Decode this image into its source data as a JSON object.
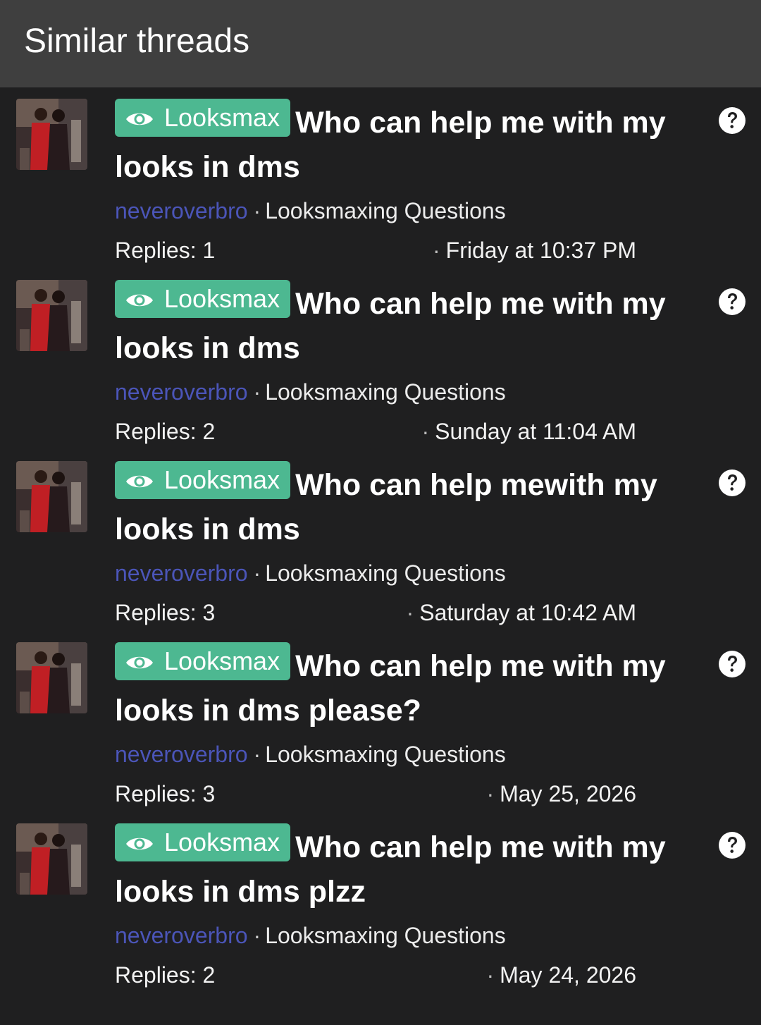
{
  "header": {
    "title": "Similar threads"
  },
  "colors": {
    "prefix_bg": "#4db891",
    "author": "#4b55b8",
    "background": "#1f1f20",
    "header_bg": "#3f3f3f"
  },
  "threads": [
    {
      "prefix": "Looksmax",
      "title": "Who can help me with my looks in dms",
      "author": "neveroverbro",
      "separator": "·",
      "forum": "Looksmaxing Questions",
      "replies": "Replies: 1",
      "date_dot": "·",
      "date": "Friday at 10:37 PM",
      "icon": "question-circle-icon"
    },
    {
      "prefix": "Looksmax",
      "title": "Who can help me with my looks in dms",
      "author": "neveroverbro",
      "separator": "·",
      "forum": "Looksmaxing Questions",
      "replies": "Replies: 2",
      "date_dot": "·",
      "date": "Sunday at 11:04 AM",
      "icon": "question-circle-icon"
    },
    {
      "prefix": "Looksmax",
      "title": "Who can help mewith my looks in dms",
      "author": "neveroverbro",
      "separator": "·",
      "forum": "Looksmaxing Questions",
      "replies": "Replies: 3",
      "date_dot": "·",
      "date": "Saturday at 10:42 AM",
      "icon": "question-circle-icon"
    },
    {
      "prefix": "Looksmax",
      "title": "Who can help me with my looks in dms please?",
      "author": "neveroverbro",
      "separator": "·",
      "forum": "Looksmaxing Questions",
      "replies": "Replies: 3",
      "date_dot": "·",
      "date": "May 25, 2026",
      "icon": "question-circle-icon"
    },
    {
      "prefix": "Looksmax",
      "title": "Who can help me with my looks in dms plzz",
      "author": "neveroverbro",
      "separator": "·",
      "forum": "Looksmaxing Questions",
      "replies": "Replies: 2",
      "date_dot": "·",
      "date": "May 24, 2026",
      "icon": "question-circle-icon"
    }
  ]
}
